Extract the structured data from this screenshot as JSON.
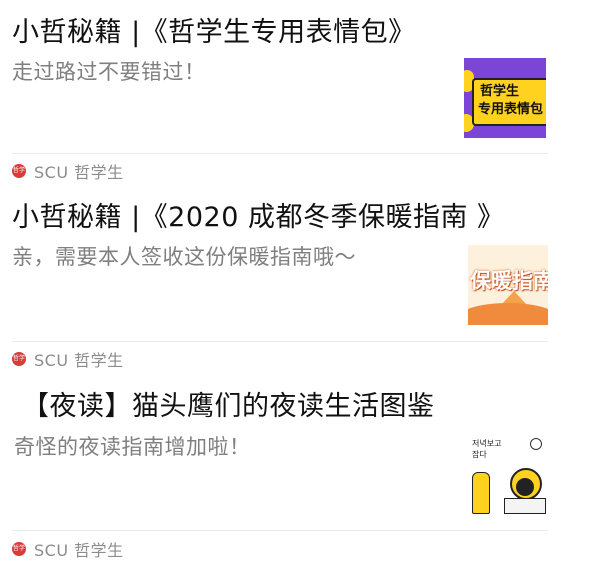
{
  "articles": [
    {
      "title": "小哲秘籍 |《哲学生专用表情包》",
      "summary": "走过路过不要错过！",
      "thumb_lines": [
        "哲学生",
        "专用表情包"
      ],
      "source": {
        "logo": "哲学",
        "name": "SCU 哲学生"
      }
    },
    {
      "title": "小哲秘籍 |《2020 成都冬季保暖指南 》",
      "summary": "亲，需要本人签收这份保暖指南哦～",
      "thumb_text": "保暖指南",
      "source": {
        "logo": "哲学",
        "name": "SCU 哲学生"
      }
    },
    {
      "title": "【夜读】猫头鹰们的夜读生活图鉴",
      "summary": "奇怪的夜读指南增加啦！",
      "thumb_text_top": "저녁보고",
      "thumb_text_sub": "잡다",
      "source": {
        "logo": "哲学",
        "name": "SCU 哲学生"
      }
    }
  ],
  "colors": {
    "accent_red": "#d93a3a",
    "purple": "#7b46d8",
    "yellow": "#ffd21f",
    "orange": "#f08a3c"
  }
}
